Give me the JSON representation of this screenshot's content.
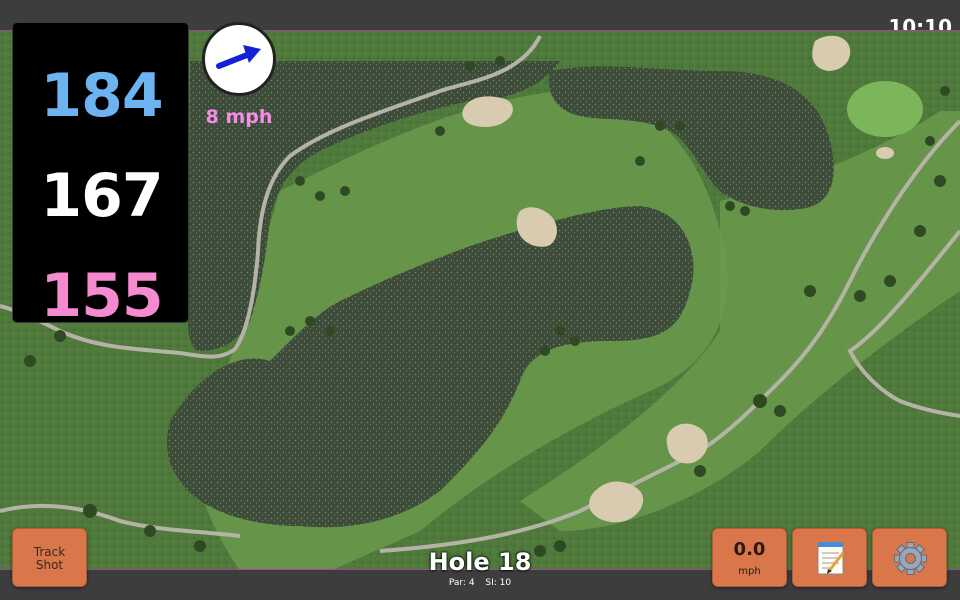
{
  "status": {
    "clock": "10:10"
  },
  "distances": {
    "back": "184",
    "middle": "167",
    "front": "155"
  },
  "wind": {
    "speed_label": "8 mph",
    "direction_icon": "arrow-right-icon"
  },
  "buttons": {
    "track_shot_label": "Track\nShot",
    "speed_value": "0.0",
    "speed_unit": "mph",
    "notes_icon": "notepad-icon",
    "settings_icon": "gear-icon"
  },
  "hole": {
    "title": "Hole 18",
    "par": "Par: 4",
    "si": "SI: 10"
  },
  "colors": {
    "back": "#6db3f2",
    "middle": "#ffffff",
    "front": "#f58ad0",
    "wind_label": "#f48de8",
    "button": "#d9764a",
    "water": "#3d4e3a",
    "fairway": "#6f9b52",
    "rough": "#4f7a3c"
  }
}
